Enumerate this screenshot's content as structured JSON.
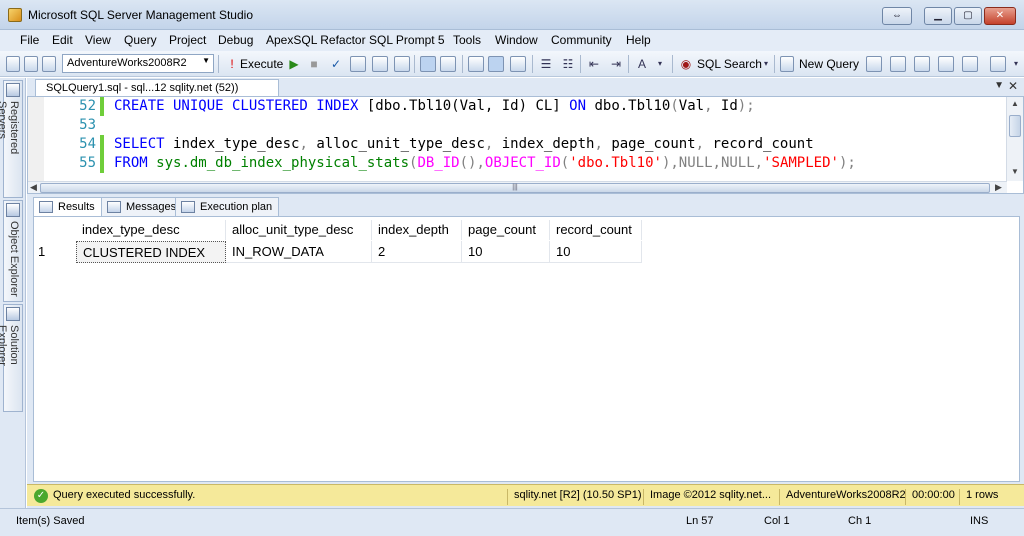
{
  "window": {
    "title": "Microsoft SQL Server Management Studio"
  },
  "menu": [
    "File",
    "Edit",
    "View",
    "Query",
    "Project",
    "Debug",
    "ApexSQL Refactor",
    "SQL Prompt 5",
    "Tools",
    "Window",
    "Community",
    "Help"
  ],
  "toolbar": {
    "database": "AdventureWorks2008R2",
    "execute_label": "Execute",
    "sql_search_label": "SQL Search",
    "new_query_label": "New Query"
  },
  "side_panels": [
    "Registered Servers",
    "Object Explorer",
    "Solution Explorer"
  ],
  "document_tab": {
    "label": "SQLQuery1.sql - sql...12 sqlity.net (52))"
  },
  "editor": {
    "lines": [
      {
        "num": "52",
        "changed": true,
        "parts": [
          {
            "cls": "kw",
            "text": "CREATE UNIQUE CLUSTERED INDEX "
          },
          {
            "cls": "plain",
            "text": "[dbo.Tbl10(Val, Id) CL] "
          },
          {
            "cls": "kw",
            "text": "ON "
          },
          {
            "cls": "plain",
            "text": "dbo.Tbl10"
          },
          {
            "cls": "gray",
            "text": "("
          },
          {
            "cls": "plain",
            "text": "Val"
          },
          {
            "cls": "gray",
            "text": ", "
          },
          {
            "cls": "plain",
            "text": "Id"
          },
          {
            "cls": "gray",
            "text": ");"
          }
        ]
      },
      {
        "num": "53",
        "changed": false,
        "parts": []
      },
      {
        "num": "54",
        "changed": true,
        "parts": [
          {
            "cls": "kw",
            "text": "SELECT "
          },
          {
            "cls": "plain",
            "text": "index_type_desc"
          },
          {
            "cls": "gray",
            "text": ", "
          },
          {
            "cls": "plain",
            "text": "alloc_unit_type_desc"
          },
          {
            "cls": "gray",
            "text": ", "
          },
          {
            "cls": "plain",
            "text": "index_depth"
          },
          {
            "cls": "gray",
            "text": ", "
          },
          {
            "cls": "plain",
            "text": "page_count"
          },
          {
            "cls": "gray",
            "text": ", "
          },
          {
            "cls": "plain",
            "text": "record_count"
          }
        ]
      },
      {
        "num": "55",
        "changed": true,
        "parts": [
          {
            "cls": "kw",
            "text": "FROM "
          },
          {
            "cls": "grn",
            "text": "sys.dm_db_index_physical_stats"
          },
          {
            "cls": "gray",
            "text": "("
          },
          {
            "cls": "fn",
            "text": "DB_ID"
          },
          {
            "cls": "gray",
            "text": "(),"
          },
          {
            "cls": "fn",
            "text": "OBJECT_ID"
          },
          {
            "cls": "gray",
            "text": "("
          },
          {
            "cls": "str",
            "text": "'dbo.Tbl10'"
          },
          {
            "cls": "gray",
            "text": "),NULL,NULL,"
          },
          {
            "cls": "str",
            "text": "'SAMPLED'"
          },
          {
            "cls": "gray",
            "text": ");"
          }
        ]
      }
    ]
  },
  "results": {
    "tabs": [
      "Results",
      "Messages",
      "Execution plan"
    ],
    "columns": [
      "index_type_desc",
      "alloc_unit_type_desc",
      "index_depth",
      "page_count",
      "record_count"
    ],
    "rows": [
      {
        "num": "1",
        "cells": [
          "CLUSTERED INDEX",
          "IN_ROW_DATA",
          "2",
          "10",
          "10"
        ]
      }
    ]
  },
  "query_status": {
    "message": "Query executed successfully.",
    "server": "sqlity.net [R2] (10.50 SP1)",
    "user": "Image ©2012 sqlity.net...",
    "database": "AdventureWorks2008R2",
    "elapsed": "00:00:00",
    "rows": "1 rows"
  },
  "statusbar": {
    "left": "Item(s) Saved",
    "ln": "Ln 57",
    "col": "Col 1",
    "ch": "Ch 1",
    "mode": "INS"
  },
  "colors": {
    "keyword": "#0000ff",
    "function": "#ff00ff",
    "string": "#ff0000",
    "system_object": "#008000",
    "line_number": "#2b91af",
    "change_marker": "#6fce3a",
    "success_strip": "#f5e99a"
  }
}
